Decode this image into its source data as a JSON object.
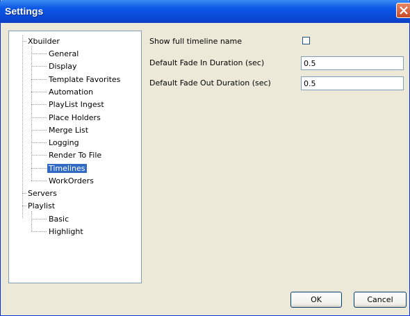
{
  "window": {
    "title": "Settings"
  },
  "tree": {
    "items": [
      {
        "label": "Xbuilder"
      },
      {
        "label": "General"
      },
      {
        "label": "Display"
      },
      {
        "label": "Template Favorites"
      },
      {
        "label": "Automation"
      },
      {
        "label": "PlayList Ingest"
      },
      {
        "label": "Place Holders"
      },
      {
        "label": "Merge List"
      },
      {
        "label": "Logging"
      },
      {
        "label": "Render To File"
      },
      {
        "label": "Timelines",
        "selected": true
      },
      {
        "label": "WorkOrders"
      },
      {
        "label": "Servers"
      },
      {
        "label": "Playlist"
      },
      {
        "label": "Basic"
      },
      {
        "label": "Highlight"
      }
    ]
  },
  "settings": {
    "show_full_timeline_name": {
      "label": "Show full timeline name",
      "checked": false
    },
    "fade_in": {
      "label": "Default Fade In Duration (sec)",
      "value": "0.5"
    },
    "fade_out": {
      "label": "Default Fade Out Duration (sec)",
      "value": "0.5"
    }
  },
  "buttons": {
    "ok": "OK",
    "cancel": "Cancel"
  }
}
